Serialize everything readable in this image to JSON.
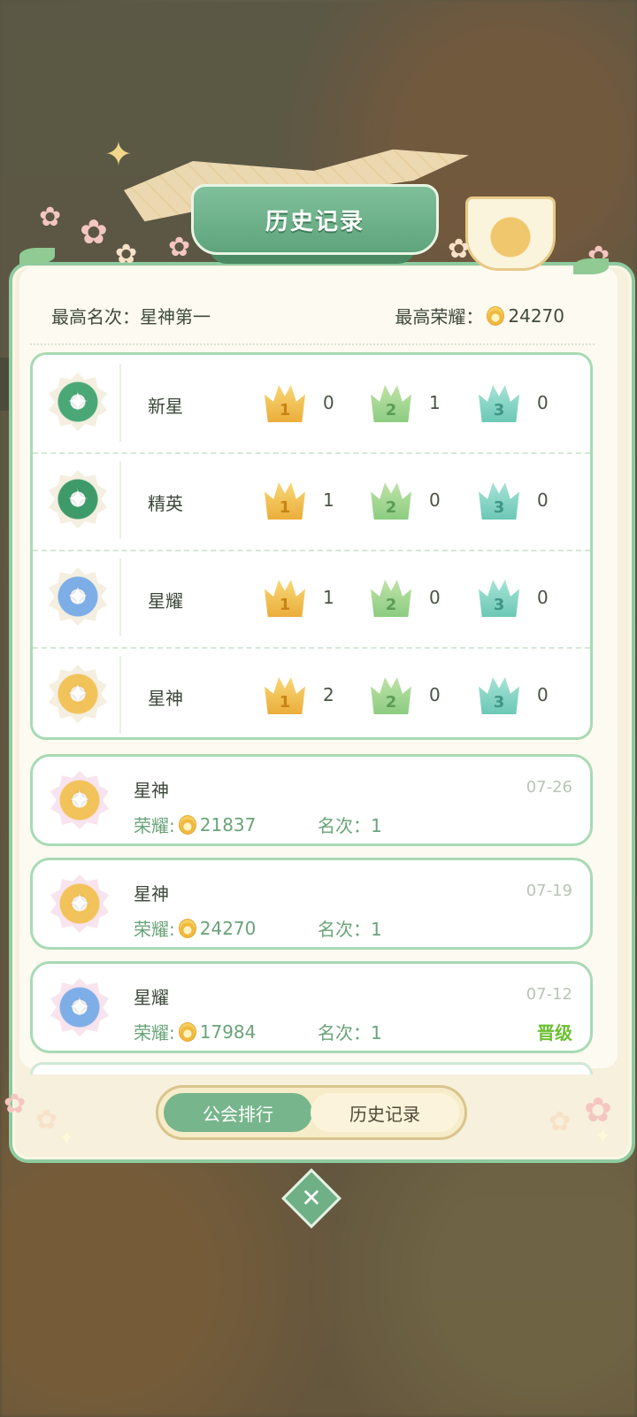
{
  "banner": {
    "title": "历史记录"
  },
  "summary": {
    "best_rank_label": "最高名次：星神第一",
    "best_honor_label": "最高荣耀：",
    "best_honor_value": "24270"
  },
  "tiers": [
    {
      "name": "新星",
      "first": "0",
      "second": "1",
      "third": "0",
      "badge_color": "#4aa877"
    },
    {
      "name": "精英",
      "first": "1",
      "second": "0",
      "third": "0",
      "badge_color": "#3f9a6a"
    },
    {
      "name": "星耀",
      "first": "1",
      "second": "0",
      "third": "0",
      "badge_color": "#7eaee8"
    },
    {
      "name": "星神",
      "first": "2",
      "second": "0",
      "third": "0",
      "badge_color": "#f2c35a"
    }
  ],
  "crown_labels": [
    "1",
    "2",
    "3"
  ],
  "history": [
    {
      "tier": "星神",
      "date": "07-26",
      "honor_label": "荣耀:",
      "honor": "21837",
      "rank_label": "名次：1",
      "badge_color": "#f2c35a",
      "promote": ""
    },
    {
      "tier": "星神",
      "date": "07-19",
      "honor_label": "荣耀:",
      "honor": "24270",
      "rank_label": "名次：1",
      "badge_color": "#f2c35a",
      "promote": ""
    },
    {
      "tier": "星耀",
      "date": "07-12",
      "honor_label": "荣耀:",
      "honor": "17984",
      "rank_label": "名次：1",
      "badge_color": "#7eaee8",
      "promote": "晋级"
    }
  ],
  "tabs": {
    "guild_rank": "公会排行",
    "history": "历史记录"
  },
  "close_icon": "✕",
  "colors": {
    "accent": "#77b58c",
    "border": "#a8dab5",
    "promote": "#6cbf33"
  }
}
